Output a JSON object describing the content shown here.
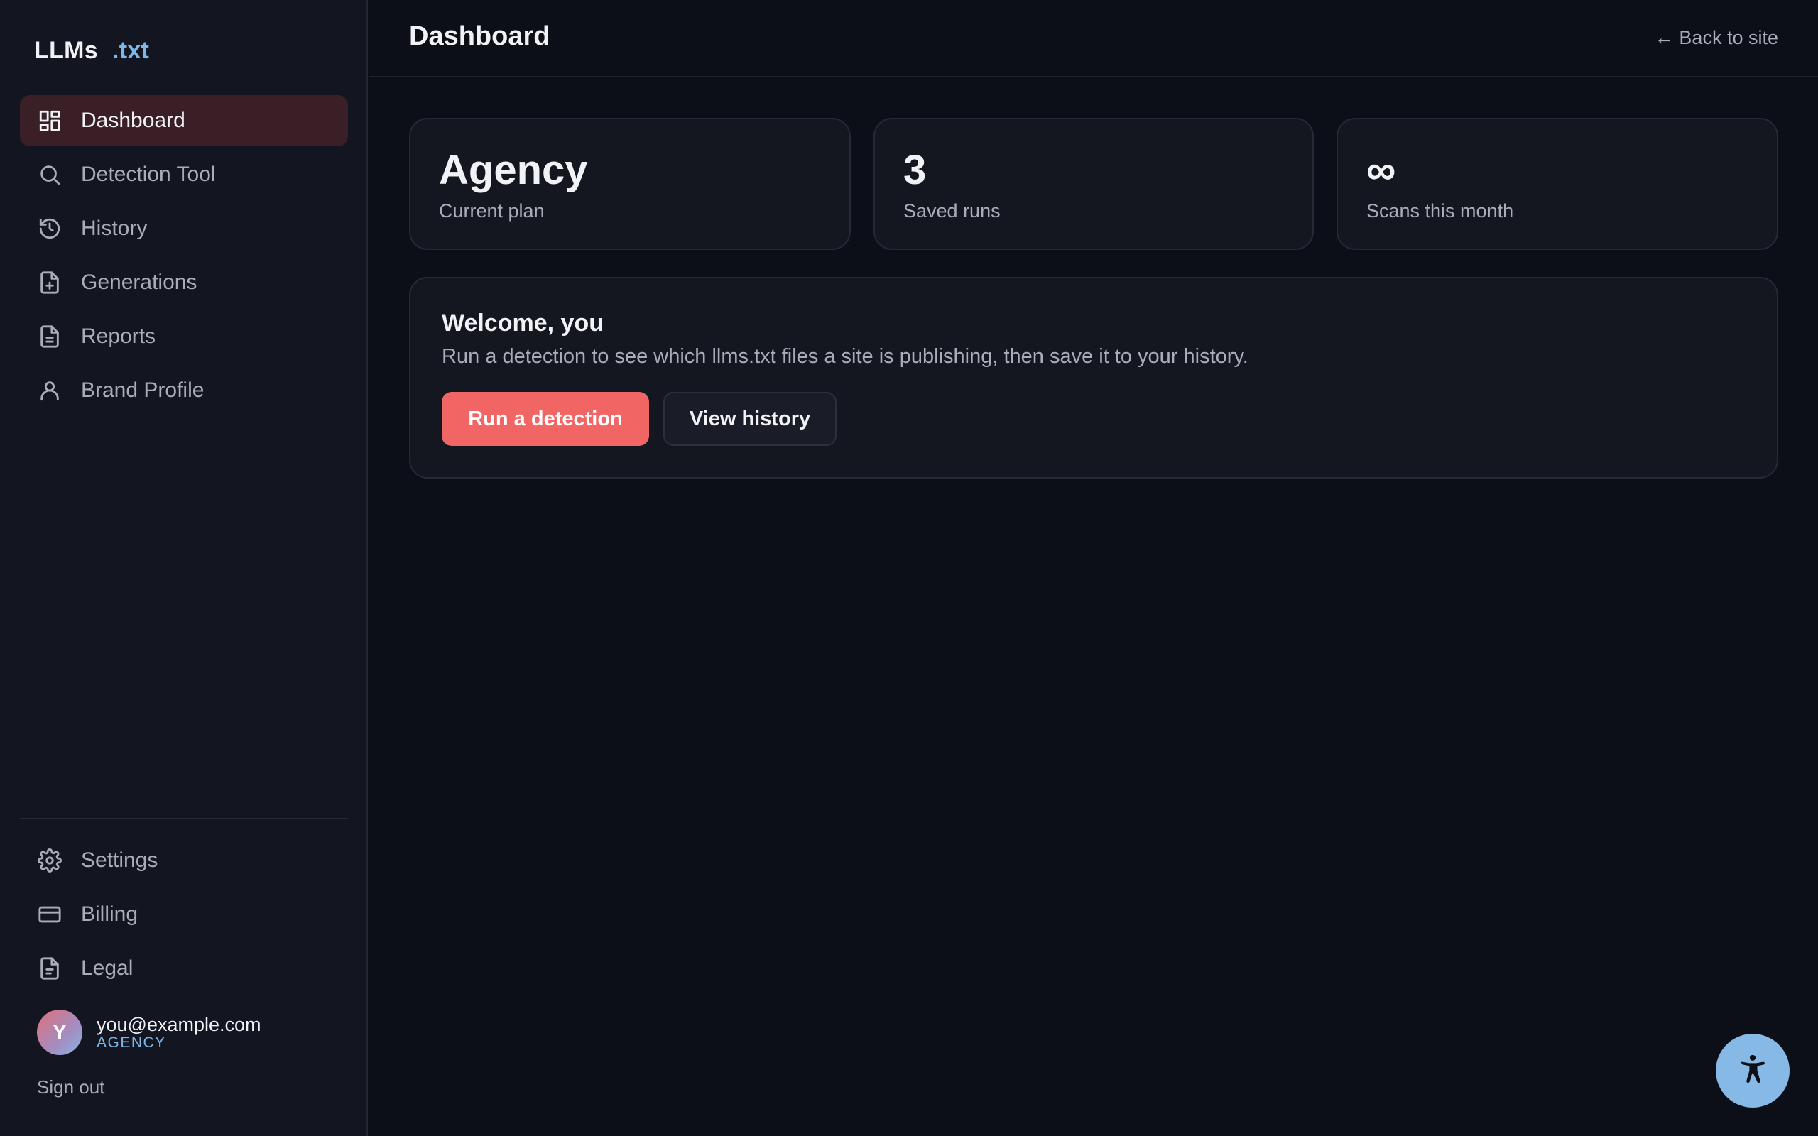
{
  "brand": {
    "name_a": "LLMs",
    "name_b": ".txt"
  },
  "sidebar": {
    "items": [
      {
        "label": "Dashboard",
        "icon": "dashboard-icon",
        "active": true
      },
      {
        "label": "Detection Tool",
        "icon": "search-icon"
      },
      {
        "label": "History",
        "icon": "history-icon"
      },
      {
        "label": "Generations",
        "icon": "file-plus-icon"
      },
      {
        "label": "Reports",
        "icon": "file-text-icon"
      },
      {
        "label": "Brand Profile",
        "icon": "user-icon"
      }
    ],
    "bottom_items": [
      {
        "label": "Settings",
        "icon": "gear-icon"
      },
      {
        "label": "Billing",
        "icon": "credit-card-icon"
      },
      {
        "label": "Legal",
        "icon": "file-text-icon"
      }
    ]
  },
  "user": {
    "initial": "Y",
    "email": "you@example.com",
    "plan": "AGENCY",
    "sign_out": "Sign out"
  },
  "header": {
    "title": "Dashboard",
    "back_link": "← Back to site"
  },
  "stats": [
    {
      "value": "Agency",
      "label": "Current plan"
    },
    {
      "value": "3",
      "label": "Saved runs"
    },
    {
      "value": "∞",
      "label": "Scans this month"
    }
  ],
  "welcome": {
    "title": "Welcome, you",
    "text": "Run a detection to see which llms.txt files a site is publishing, then save it to your history.",
    "primary_button": "Run a detection",
    "secondary_button": "View history"
  },
  "colors": {
    "accent": "#f26565",
    "brand_blue": "#7fb6ea",
    "active_nav_bg": "#3a1f26",
    "accessibility_button": "#86b9e6"
  }
}
